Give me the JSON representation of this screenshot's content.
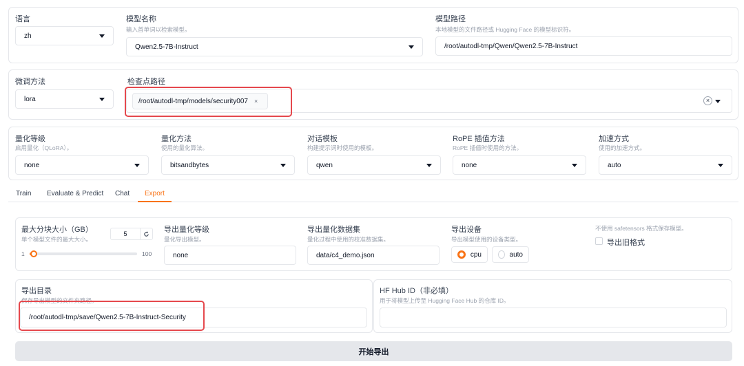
{
  "language": {
    "label": "语言",
    "value": "zh"
  },
  "model_name": {
    "label": "模型名称",
    "hint": "输入首单词以检索模型。",
    "value": "Qwen2.5-7B-Instruct"
  },
  "model_path": {
    "label": "模型路径",
    "hint": "本地模型的文件路径或 Hugging Face 的模型标识符。",
    "value": "/root/autodl-tmp/Qwen/Qwen2.5-7B-Instruct"
  },
  "finetune": {
    "label": "微调方法",
    "value": "lora"
  },
  "checkpoint": {
    "label": "检查点路径",
    "tag": "/root/autodl-tmp/models/security007",
    "tag_close": "×",
    "clear": "×"
  },
  "quant_bit": {
    "label": "量化等级",
    "hint": "启用量化（QLoRA）。",
    "value": "none"
  },
  "quant_method": {
    "label": "量化方法",
    "hint": "使用的量化算法。",
    "value": "bitsandbytes"
  },
  "template": {
    "label": "对话模板",
    "hint": "构建提示词时使用的模板。",
    "value": "qwen"
  },
  "rope": {
    "label": "RoPE 插值方法",
    "hint": "RoPE 插值时使用的方法。",
    "value": "none"
  },
  "booster": {
    "label": "加速方式",
    "hint": "使用的加速方式。",
    "value": "auto"
  },
  "tabs": [
    "Train",
    "Evaluate & Predict",
    "Chat",
    "Export"
  ],
  "export": {
    "shard": {
      "label": "最大分块大小（GB）",
      "hint": "单个模型文件的最大大小。",
      "value": "5",
      "min": "1",
      "max": "100",
      "level": 0.04
    },
    "quant_bit": {
      "label": "导出量化等级",
      "hint": "量化导出模型。",
      "value": "none"
    },
    "quant_dataset": {
      "label": "导出量化数据集",
      "hint": "量化过程中使用的校准数据集。",
      "value": "data/c4_demo.json"
    },
    "device": {
      "label": "导出设备",
      "hint": "导出模型使用的设备类型。",
      "options": [
        "cpu",
        "auto"
      ],
      "selected": "cpu"
    },
    "legacy": {
      "hint": "不使用 safetensors 格式保存模型。",
      "label": "导出旧格式"
    },
    "dir": {
      "label": "导出目录",
      "hint": "保存导出模型的文件夹路径。",
      "value": "/root/autodl-tmp/save/Qwen2.5-7B-Instruct-Security"
    },
    "hub": {
      "label": "HF Hub ID（非必填）",
      "hint": "用于将模型上传至 Hugging Face Hub 的仓库 ID。",
      "value": ""
    },
    "button": "开始导出"
  },
  "colors": {
    "accent": "#f97316",
    "highlight": "#e5484d"
  }
}
